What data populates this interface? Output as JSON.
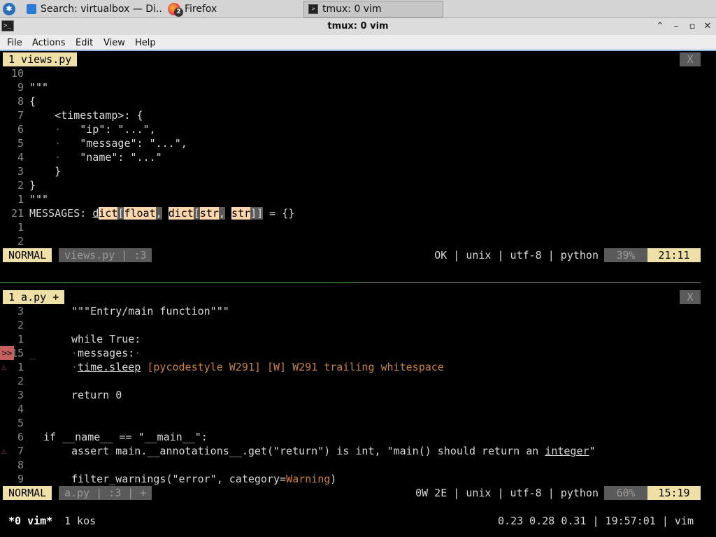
{
  "taskbar": {
    "tasks": [
      {
        "label": "Search: virtualbox — Di..."
      },
      {
        "label": "Firefox",
        "badge": "2"
      },
      {
        "label": "tmux: 0 vim"
      }
    ]
  },
  "window": {
    "title": "tmux: 0 vim",
    "icon_text": ">_"
  },
  "menubar": {
    "items": [
      "File",
      "Actions",
      "Edit",
      "View",
      "Help"
    ]
  },
  "top_pane": {
    "tab_label": "1 views.py",
    "tab_close": "X",
    "lines": [
      {
        "ln": "10",
        "text": ""
      },
      {
        "ln": "9",
        "text": "\"\"\""
      },
      {
        "ln": "8",
        "text": "{"
      },
      {
        "ln": "7",
        "text": "    <timestamp>: {"
      },
      {
        "ln": "6",
        "dot": "    ·",
        "text": "   \"ip\": \"...\","
      },
      {
        "ln": "5",
        "dot": "    ·",
        "text": "   \"message\": \"...\","
      },
      {
        "ln": "4",
        "dot": "    ·",
        "text": "   \"name\": \"...\""
      },
      {
        "ln": "3",
        "text": "    }"
      },
      {
        "ln": "2",
        "text": "}"
      },
      {
        "ln": "1",
        "text": "\"\"\""
      },
      {
        "ln": "21",
        "text": "MESSAGES: ",
        "tokens": [
          "d",
          "ict",
          "[",
          "float",
          ",",
          " ",
          "dict",
          "[",
          "str",
          ",",
          " ",
          "str",
          "]",
          "]"
        ],
        "tail": " = {}"
      },
      {
        "ln": "1",
        "text": ""
      },
      {
        "ln": "2",
        "text": ""
      }
    ],
    "status": {
      "mode": "NORMAL",
      "file": "views.py | :3",
      "info": "OK | unix | utf-8 | python",
      "pct": "39%",
      "pos": "21:11"
    }
  },
  "bottom_pane": {
    "tab_label": "1 a.py +",
    "tab_close": "X",
    "lines": [
      {
        "ln": "3",
        "text": "\"\"\"Entry/main function\"\"\""
      },
      {
        "ln": "2",
        "text": ""
      },
      {
        "ln": "1",
        "text": "while True:"
      },
      {
        "ln": "15",
        "sign": ">>",
        "pre": "_",
        "dot": "·",
        "text": "messages:",
        "trail": "·"
      },
      {
        "ln": "1",
        "sign": "⚠",
        "dot": "·",
        "text": "time.sleep",
        "warn": " [pycodestyle W291] [W] W291 trailing whitespace"
      },
      {
        "ln": "2",
        "text": ""
      },
      {
        "ln": "3",
        "text": "return 0"
      },
      {
        "ln": "4",
        "text": ""
      },
      {
        "ln": "5",
        "text": ""
      },
      {
        "ln": "6",
        "text": "if __name__ == \"__main__\":"
      },
      {
        "ln": "7",
        "sign": "⚠",
        "text": "assert main.__annotations__.get(\"return\") is int, \"main() should return an ",
        "ul": "integer",
        "tail": "\""
      },
      {
        "ln": "8",
        "text": ""
      },
      {
        "ln": "9",
        "text": "filter_warnings(\"error\", category=",
        "warn": "Warning",
        "tail": ")"
      }
    ],
    "status": {
      "mode": "NORMAL",
      "file": "a.py | :3 | +",
      "info": "0W 2E | unix | utf-8 | python",
      "pct": "60%",
      "pos": "15:19"
    }
  },
  "tmux": {
    "window": "*0 vim*",
    "window2": "1 kos",
    "right": "0.23 0.28 0.31 | 19:57:01 | vim"
  },
  "colors": {
    "accent": "#efe0a7",
    "highlight": "#fcd6ad",
    "warning": "#c8823d",
    "error_sign": "#c46060",
    "divider": "#4fc04f"
  }
}
